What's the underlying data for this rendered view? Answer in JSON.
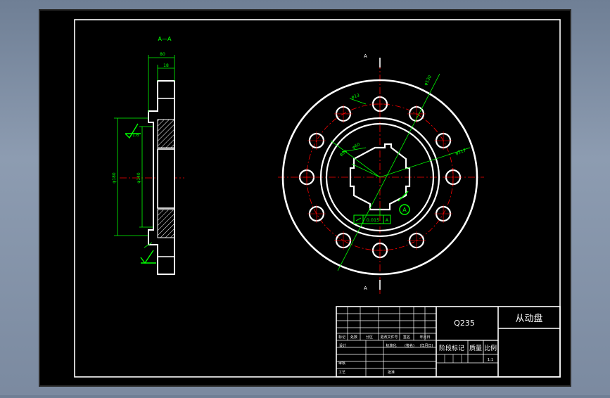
{
  "section": {
    "label": "A—A"
  },
  "dims": {
    "width_total": "80",
    "width_hub": "18",
    "dia_outer": "φ180",
    "dia_inner": "φ140",
    "roughness": "1.6"
  },
  "plan": {
    "section_mark": "A",
    "pcd": "φ130",
    "hole_dia": "φ13",
    "bore_dia": "φ60",
    "recess_dia": "φ99",
    "outer_dia": "φ217",
    "tolerance_value": "0.015",
    "tolerance_datum": "A",
    "datum_letter": "A"
  },
  "title_block": {
    "material": "Q235",
    "part_name": "从动盘",
    "headers": [
      "标记",
      "处数",
      "分区",
      "更改文件号",
      "签名",
      "年月日"
    ],
    "design_row": [
      "设计",
      "",
      "",
      "标准化",
      "(签名)",
      "(年月日)"
    ],
    "review_label": "审核",
    "process_label": "工艺",
    "approve_label": "批准",
    "stage_label": "阶段标记",
    "mass_label": "质量",
    "scale_label": "比例",
    "scale_value": "1:1"
  },
  "colors": {
    "background": "#000000",
    "outline": "#ffffff",
    "centerline": "#ff0000",
    "dimension": "#00ff00"
  }
}
